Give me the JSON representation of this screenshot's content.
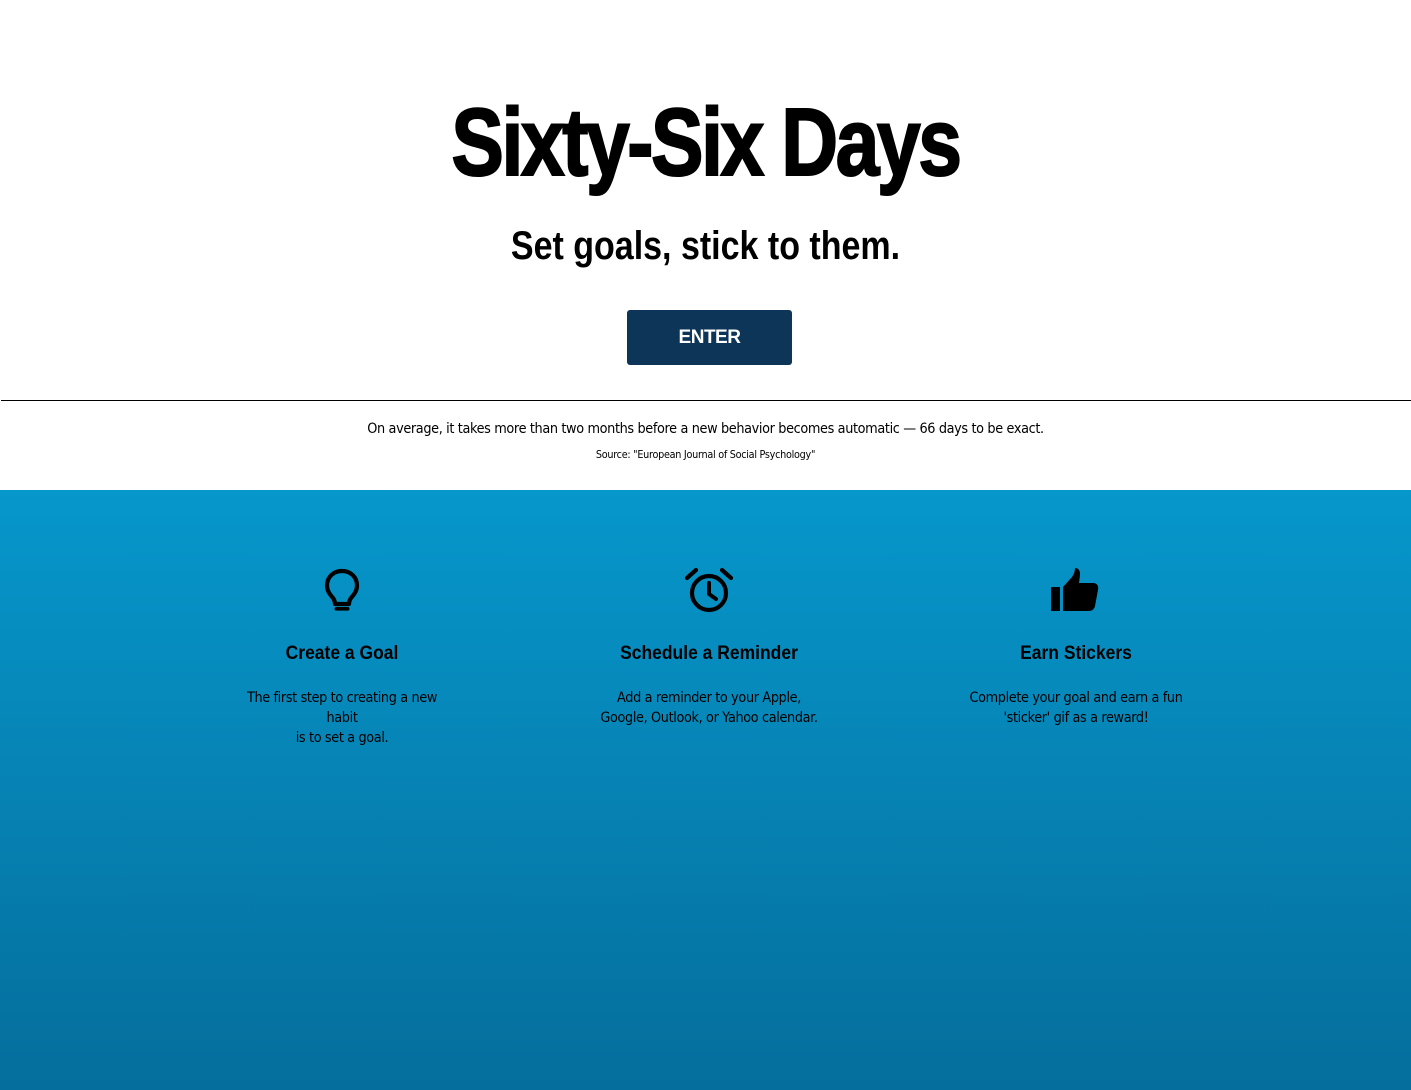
{
  "hero": {
    "title": "Sixty-Six Days",
    "subtitle": "Set goals, stick to them.",
    "enter_label": "ENTER"
  },
  "fact": {
    "text": "On average, it takes more than two months before a new behavior becomes automatic — 66 days to be exact.",
    "source": "Source: \"European Journal of Social Psychology\""
  },
  "features": [
    {
      "icon": "lightbulb-icon",
      "title": "Create a Goal",
      "line1": "The first step to creating a new habit",
      "line2": "is to set a goal."
    },
    {
      "icon": "alarm-clock-icon",
      "title": "Schedule a Reminder",
      "line1": "Add a reminder to your Apple,",
      "line2": "Google, Outlook, or Yahoo calendar."
    },
    {
      "icon": "thumbs-up-icon",
      "title": "Earn Stickers",
      "line1": "Complete your goal and earn a fun",
      "line2": "'sticker' gif as a reward!"
    }
  ],
  "colors": {
    "button_bg": "#0c3558",
    "features_gradient_top": "#0697cb",
    "features_gradient_bottom": "#056e9c"
  }
}
